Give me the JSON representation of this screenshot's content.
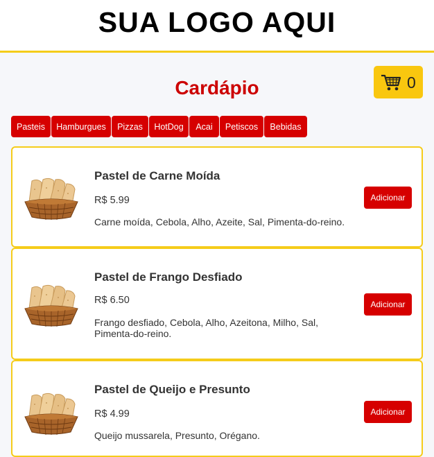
{
  "header": {
    "logo_text": "SUA LOGO AQUI"
  },
  "page": {
    "title": "Cardápio"
  },
  "cart": {
    "count": "0",
    "icon": "shopping-cart-icon"
  },
  "categories": [
    {
      "label": "Pasteis"
    },
    {
      "label": "Hamburgues"
    },
    {
      "label": "Pizzas"
    },
    {
      "label": "HotDog"
    },
    {
      "label": "Acai"
    },
    {
      "label": "Petiscos"
    },
    {
      "label": "Bebidas"
    }
  ],
  "products": [
    {
      "name": "Pastel de Carne Moída",
      "price": "R$ 5.99",
      "description": "Carne moída, Cebola, Alho, Azeite, Sal, Pimenta-do-reino.",
      "add_label": "Adicionar"
    },
    {
      "name": "Pastel de Frango Desfiado",
      "price": "R$ 6.50",
      "description": "Frango desfiado, Cebola, Alho, Azeitona, Milho, Sal, Pimenta-do-reino.",
      "add_label": "Adicionar"
    },
    {
      "name": "Pastel de Queijo e Presunto",
      "price": "R$ 4.99",
      "description": "Queijo mussarela, Presunto, Orégano.",
      "add_label": "Adicionar"
    }
  ],
  "colors": {
    "accent_red": "#d60000",
    "title_red": "#cc0000",
    "yellow": "#f5cc1a",
    "cart_yellow": "#f9c70f"
  }
}
